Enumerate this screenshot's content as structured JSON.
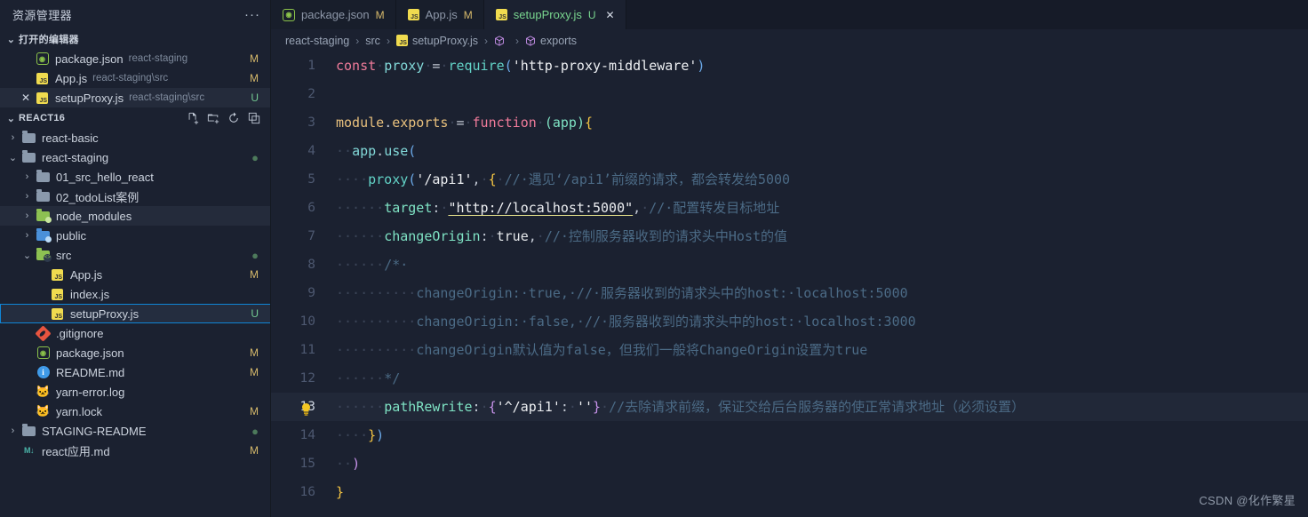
{
  "sidebar": {
    "title": "资源管理器",
    "more_label": "···",
    "open_editors": {
      "label": "打开的编辑器",
      "items": [
        {
          "icon": "npm-icon",
          "name": "package.json",
          "path": "react-staging",
          "state": "M",
          "state_kind": "m",
          "closable": false
        },
        {
          "icon": "js-icon",
          "name": "App.js",
          "path": "react-staging\\src",
          "state": "M",
          "state_kind": "m",
          "closable": false
        },
        {
          "icon": "js-icon",
          "name": "setupProxy.js",
          "path": "react-staging\\src",
          "state": "U",
          "state_kind": "u",
          "closable": true
        }
      ]
    },
    "workspace": {
      "label": "REACT16",
      "actions": [
        "new-file-icon",
        "new-folder-icon",
        "refresh-icon",
        "collapse-all-icon"
      ],
      "tree": [
        {
          "name": "react-basic",
          "kind": "folder",
          "icon": "folder-icon",
          "chev": "collapsed",
          "depth": 1,
          "state": "",
          "state_kind": ""
        },
        {
          "name": "react-staging",
          "kind": "folder",
          "icon": "folder-open-icon",
          "chev": "expanded",
          "depth": 1,
          "state": "●",
          "state_kind": "dot"
        },
        {
          "name": "01_src_hello_react",
          "kind": "folder",
          "icon": "folder-icon",
          "chev": "collapsed",
          "depth": 2,
          "state": "",
          "state_kind": ""
        },
        {
          "name": "02_todoList案例",
          "kind": "folder",
          "icon": "folder-icon",
          "chev": "collapsed",
          "depth": 2,
          "state": "",
          "state_kind": ""
        },
        {
          "name": "node_modules",
          "kind": "folder",
          "icon": "folder-node-icon",
          "chev": "collapsed",
          "depth": 2,
          "state": "",
          "state_kind": "",
          "hover": true
        },
        {
          "name": "public",
          "kind": "folder",
          "icon": "folder-public-icon",
          "chev": "collapsed",
          "depth": 2,
          "state": "",
          "state_kind": ""
        },
        {
          "name": "src",
          "kind": "folder",
          "icon": "folder-src-icon",
          "chev": "expanded",
          "depth": 2,
          "state": "●",
          "state_kind": "dot"
        },
        {
          "name": "App.js",
          "kind": "file",
          "icon": "js-icon",
          "chev": "none",
          "depth": 3,
          "state": "M",
          "state_kind": "m"
        },
        {
          "name": "index.js",
          "kind": "file",
          "icon": "js-icon",
          "chev": "none",
          "depth": 3,
          "state": "",
          "state_kind": ""
        },
        {
          "name": "setupProxy.js",
          "kind": "file",
          "icon": "js-icon",
          "chev": "none",
          "depth": 3,
          "state": "U",
          "state_kind": "u",
          "selected": true
        },
        {
          "name": ".gitignore",
          "kind": "file",
          "icon": "git-icon",
          "chev": "none",
          "depth": 2,
          "state": "",
          "state_kind": ""
        },
        {
          "name": "package.json",
          "kind": "file",
          "icon": "npm-icon",
          "chev": "none",
          "depth": 2,
          "state": "M",
          "state_kind": "m"
        },
        {
          "name": "README.md",
          "kind": "file",
          "icon": "info-icon",
          "chev": "none",
          "depth": 2,
          "state": "M",
          "state_kind": "m"
        },
        {
          "name": "yarn-error.log",
          "kind": "file",
          "icon": "yarn-icon",
          "chev": "none",
          "depth": 2,
          "state": "",
          "state_kind": ""
        },
        {
          "name": "yarn.lock",
          "kind": "file",
          "icon": "yarn-icon",
          "chev": "none",
          "depth": 2,
          "state": "M",
          "state_kind": "m"
        },
        {
          "name": "STAGING-README",
          "kind": "folder",
          "icon": "folder-icon",
          "chev": "collapsed",
          "depth": 1,
          "state": "●",
          "state_kind": "dot"
        },
        {
          "name": "react应用.md",
          "kind": "file",
          "icon": "markdown-icon",
          "chev": "none",
          "depth": 1,
          "state": "M",
          "state_kind": "m"
        }
      ]
    }
  },
  "tabs": [
    {
      "icon": "npm-icon",
      "label": "package.json",
      "state": "M",
      "state_kind": "m",
      "active": false,
      "closable": false
    },
    {
      "icon": "js-icon",
      "label": "App.js",
      "state": "M",
      "state_kind": "m",
      "active": false,
      "closable": false
    },
    {
      "icon": "js-icon",
      "label": "setupProxy.js",
      "state": "U",
      "state_kind": "u",
      "active": true,
      "closable": true
    }
  ],
  "breadcrumb": [
    {
      "label": "react-staging",
      "icon": ""
    },
    {
      "label": "src",
      "icon": ""
    },
    {
      "label": "setupProxy.js",
      "icon": "js-icon"
    },
    {
      "label": "<unknown>",
      "icon": "symbol-cube-icon"
    },
    {
      "label": "exports",
      "icon": "symbol-cube-icon"
    }
  ],
  "editor": {
    "active_line": 13,
    "lightbulb_line": 13,
    "lines": [
      {
        "n": 1,
        "tokens": [
          {
            "t": "const",
            "c": "t-kw"
          },
          {
            "t": "·",
            "c": "dot-ws"
          },
          {
            "t": "proxy",
            "c": "t-var"
          },
          {
            "t": "·",
            "c": "dot-ws"
          },
          {
            "t": "=",
            "c": "t-plain"
          },
          {
            "t": "·",
            "c": "dot-ws"
          },
          {
            "t": "require",
            "c": "t-fn"
          },
          {
            "t": "(",
            "c": "t-punc"
          },
          {
            "t": "'http-proxy-middleware'",
            "c": "t-mono-str"
          },
          {
            "t": ")",
            "c": "t-punc"
          }
        ]
      },
      {
        "n": 2,
        "tokens": []
      },
      {
        "n": 3,
        "tokens": [
          {
            "t": "module",
            "c": "t-obj"
          },
          {
            "t": ".",
            "c": "t-plain"
          },
          {
            "t": "exports",
            "c": "t-obj"
          },
          {
            "t": "·",
            "c": "dot-ws"
          },
          {
            "t": "=",
            "c": "t-plain"
          },
          {
            "t": "·",
            "c": "dot-ws"
          },
          {
            "t": "function",
            "c": "t-kw"
          },
          {
            "t": "·",
            "c": "dot-ws"
          },
          {
            "t": "(",
            "c": "t-prop"
          },
          {
            "t": "app",
            "c": "t-prop"
          },
          {
            "t": ")",
            "c": "t-prop"
          },
          {
            "t": "{",
            "c": "t-brace"
          }
        ]
      },
      {
        "n": 4,
        "tokens": [
          {
            "t": "··",
            "c": "dot-ws"
          },
          {
            "t": "app",
            "c": "t-var"
          },
          {
            "t": ".",
            "c": "t-plain"
          },
          {
            "t": "use",
            "c": "t-var"
          },
          {
            "t": "(",
            "c": "t-punc"
          }
        ]
      },
      {
        "n": 5,
        "tokens": [
          {
            "t": "····",
            "c": "dot-ws"
          },
          {
            "t": "proxy",
            "c": "t-fn"
          },
          {
            "t": "(",
            "c": "t-punc"
          },
          {
            "t": "'/api1'",
            "c": "t-mono-str"
          },
          {
            "t": ",",
            "c": "t-plain"
          },
          {
            "t": "·",
            "c": "dot-ws"
          },
          {
            "t": "{",
            "c": "t-brace"
          },
          {
            "t": "·",
            "c": "dot-ws"
          },
          {
            "t": "//·遇见‘/api1’前缀的请求，都会转发给5000",
            "c": "t-comment"
          }
        ]
      },
      {
        "n": 6,
        "tokens": [
          {
            "t": "······",
            "c": "dot-ws"
          },
          {
            "t": "target",
            "c": "t-prop"
          },
          {
            "t": ":",
            "c": "t-plain"
          },
          {
            "t": "·",
            "c": "dot-ws"
          },
          {
            "t": "\"http://localhost:5000\"",
            "c": "t-mono-str link-u"
          },
          {
            "t": ",",
            "c": "t-plain"
          },
          {
            "t": "·",
            "c": "dot-ws"
          },
          {
            "t": "//·配置转发目标地址",
            "c": "t-comment"
          }
        ]
      },
      {
        "n": 7,
        "tokens": [
          {
            "t": "······",
            "c": "dot-ws"
          },
          {
            "t": "changeOrigin",
            "c": "t-prop"
          },
          {
            "t": ":",
            "c": "t-plain"
          },
          {
            "t": "·",
            "c": "dot-ws"
          },
          {
            "t": "true",
            "c": "t-const"
          },
          {
            "t": ",",
            "c": "t-plain"
          },
          {
            "t": "·",
            "c": "dot-ws"
          },
          {
            "t": "//·控制服务器收到的请求头中Host的值",
            "c": "t-comment"
          }
        ]
      },
      {
        "n": 8,
        "tokens": [
          {
            "t": "······",
            "c": "dot-ws"
          },
          {
            "t": "/*·",
            "c": "t-comment"
          }
        ]
      },
      {
        "n": 9,
        "tokens": [
          {
            "t": "··········",
            "c": "dot-ws"
          },
          {
            "t": "changeOrigin:·true,·//·服务器收到的请求头中的host:·localhost:5000",
            "c": "t-comment"
          }
        ]
      },
      {
        "n": 10,
        "tokens": [
          {
            "t": "··········",
            "c": "dot-ws"
          },
          {
            "t": "changeOrigin:·false,·//·服务器收到的请求头中的host:·localhost:3000",
            "c": "t-comment"
          }
        ]
      },
      {
        "n": 11,
        "tokens": [
          {
            "t": "··········",
            "c": "dot-ws"
          },
          {
            "t": "changeOrigin默认值为false，但我们一般将ChangeOrigin设置为true",
            "c": "t-comment"
          }
        ]
      },
      {
        "n": 12,
        "tokens": [
          {
            "t": "······",
            "c": "dot-ws"
          },
          {
            "t": "*/",
            "c": "t-comment"
          }
        ]
      },
      {
        "n": 13,
        "tokens": [
          {
            "t": "······",
            "c": "dot-ws"
          },
          {
            "t": "pathRewrite",
            "c": "t-prop"
          },
          {
            "t": ":",
            "c": "t-plain"
          },
          {
            "t": "·",
            "c": "dot-ws"
          },
          {
            "t": "{",
            "c": "t-brace2"
          },
          {
            "t": "'^/api1'",
            "c": "t-mono-str"
          },
          {
            "t": ":",
            "c": "t-plain"
          },
          {
            "t": "·",
            "c": "dot-ws"
          },
          {
            "t": "''",
            "c": "t-mono-str"
          },
          {
            "t": "}",
            "c": "t-brace2"
          },
          {
            "t": "·",
            "c": "dot-ws"
          },
          {
            "t": "//去除请求前缀，保证交给后台服务器的使正常请求地址（必须设置）",
            "c": "t-comment"
          }
        ]
      },
      {
        "n": 14,
        "tokens": [
          {
            "t": "····",
            "c": "dot-ws"
          },
          {
            "t": "}",
            "c": "t-brace"
          },
          {
            "t": ")",
            "c": "t-punc"
          }
        ]
      },
      {
        "n": 15,
        "tokens": [
          {
            "t": "··",
            "c": "dot-ws"
          },
          {
            "t": ")",
            "c": "t-brace2"
          }
        ]
      },
      {
        "n": 16,
        "tokens": [
          {
            "t": "}",
            "c": "t-brace"
          }
        ]
      }
    ]
  },
  "watermark": "CSDN @化作繁星",
  "colors": {
    "background": "#1b2130",
    "sidebar_bg": "#1b2130",
    "tabbar_bg": "#161b28",
    "selection_border": "#0f85d6",
    "modified_badge": "#d6b96b",
    "untracked_badge": "#73c991",
    "comment": "#4b6a85"
  }
}
